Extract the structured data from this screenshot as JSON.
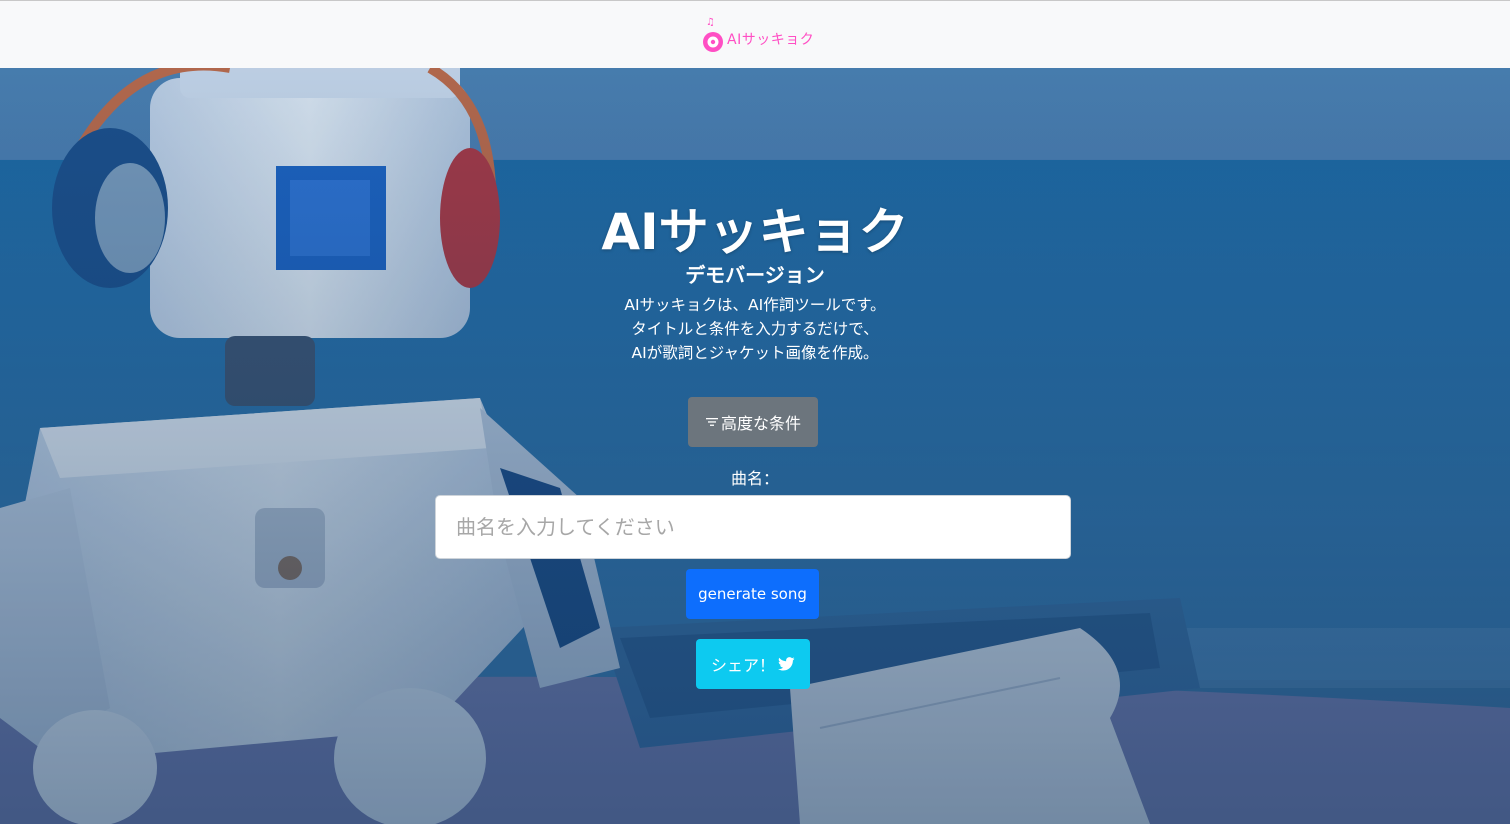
{
  "navbar": {
    "brand_label": "AIサッキョク"
  },
  "hero": {
    "title": "AIサッキョク",
    "subtitle": "デモバージョン",
    "description": [
      "AIサッキョクは、AI作詞ツールです。",
      "タイトルと条件を入力するだけで、",
      "AIが歌詞とジャケット画像を作成。"
    ]
  },
  "form": {
    "advanced_button_label": "高度な条件",
    "song_name_label": "曲名：",
    "song_name_placeholder": "曲名を入力してください",
    "song_name_value": "",
    "generate_button_label": "generate song",
    "share_button_label": "シェア！"
  },
  "colors": {
    "brand": "#ff4fc4",
    "navbar_bg": "#f8f9fa",
    "advanced_button": "#6c757d",
    "generate_button": "#0d6efd",
    "share_button": "#0dcaf0"
  },
  "icons": {
    "brand": "vinyl-record-music-notes-icon",
    "advanced": "filter-icon",
    "share": "twitter-icon"
  }
}
